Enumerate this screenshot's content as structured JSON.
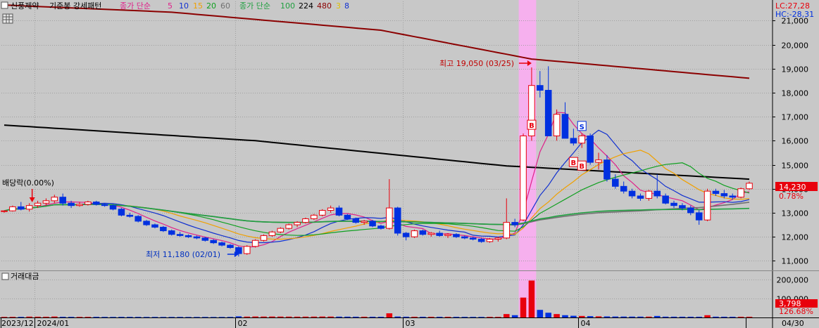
{
  "header": {
    "stock_name": "신풍제약",
    "pattern_label": "기준봉 강세패턴",
    "ma_short_label": "종가 단순",
    "ma_short_periods": [
      "5",
      "10",
      "15",
      "20",
      "60"
    ],
    "ma_long_label": "종가 단순",
    "ma_long_periods": [
      "100",
      "224",
      "480",
      "3",
      "8"
    ]
  },
  "right_top": {
    "lc": "LC:27,28",
    "hc": "HC:-28,31"
  },
  "current": {
    "price_label": "14,230",
    "change_label": "0.78%"
  },
  "volume": {
    "title": "거래대금",
    "current_label": "3,798",
    "pct_label": "126.68%"
  },
  "annotations": {
    "high": "최고 19,050 (03/25)",
    "low": "최저 11,180 (02/01)",
    "dividend": "배당락(0.00%)",
    "buy_mark": "B",
    "sell_mark": "S"
  },
  "colors": {
    "bg": "#c8c8c8",
    "up": "#e8000c",
    "down": "#0030e0",
    "ma5": "#e0208a",
    "ma10": "#1030d0",
    "ma15": "#f0a000",
    "ma20": "#10a020",
    "ma60": "#707070",
    "ma100": "#20a040",
    "ma224": "#000000",
    "ma480": "#8b0000",
    "highlight": "#f6b0ee"
  },
  "chart_data": {
    "type": "candlestick",
    "y_ticks": [
      11000,
      12000,
      13000,
      14000,
      15000,
      16000,
      17000,
      18000,
      19000,
      20000,
      21000
    ],
    "y_tick_labels": [
      "11,000",
      "12,000",
      "13,000",
      "14,000",
      "15,000",
      "16,000",
      "17,000",
      "18,000",
      "19,000",
      "20,000",
      "21,000"
    ],
    "ylim": [
      10600,
      21800
    ],
    "volume_ticks": [
      100000,
      200000
    ],
    "volume_tick_labels": [
      "100,000",
      "200,000"
    ],
    "volume_ylim": [
      0,
      230000
    ],
    "x_labels": [
      {
        "label": "2023/12",
        "index": 0
      },
      {
        "label": "2024/01",
        "index": 4
      },
      {
        "label": "02",
        "index": 28
      },
      {
        "label": "03",
        "index": 48
      },
      {
        "label": "04",
        "index": 69
      },
      {
        "label": "04/30",
        "index": 89
      }
    ],
    "n_candles": 90,
    "high_index": 63,
    "low_index": 28,
    "dividend_index": 3,
    "highlight_range": [
      62,
      63
    ],
    "candles": [
      [
        13050,
        13100,
        13000,
        13080
      ],
      [
        13080,
        13300,
        13050,
        13250
      ],
      [
        13250,
        13450,
        13100,
        13150
      ],
      [
        13150,
        13400,
        13050,
        13300
      ],
      [
        13300,
        13500,
        13200,
        13400
      ],
      [
        13400,
        13600,
        13300,
        13500
      ],
      [
        13500,
        13750,
        13400,
        13650
      ],
      [
        13650,
        13800,
        13300,
        13400
      ],
      [
        13400,
        13500,
        13200,
        13300
      ],
      [
        13300,
        13450,
        13250,
        13350
      ],
      [
        13350,
        13500,
        13300,
        13450
      ],
      [
        13450,
        13500,
        13300,
        13350
      ],
      [
        13350,
        13400,
        13250,
        13300
      ],
      [
        13300,
        13350,
        13100,
        13150
      ],
      [
        13150,
        13200,
        12850,
        12900
      ],
      [
        12900,
        13000,
        12800,
        12850
      ],
      [
        12850,
        12900,
        12600,
        12650
      ],
      [
        12650,
        12700,
        12450,
        12500
      ],
      [
        12500,
        12550,
        12350,
        12400
      ],
      [
        12400,
        12450,
        12200,
        12250
      ],
      [
        12250,
        12300,
        12050,
        12100
      ],
      [
        12100,
        12200,
        12000,
        12050
      ],
      [
        12050,
        12100,
        11950,
        12000
      ],
      [
        12000,
        12050,
        11900,
        11950
      ],
      [
        11950,
        12000,
        11800,
        11850
      ],
      [
        11850,
        11900,
        11700,
        11750
      ],
      [
        11750,
        11800,
        11600,
        11650
      ],
      [
        11650,
        11700,
        11500,
        11550
      ],
      [
        11550,
        11600,
        11180,
        11300
      ],
      [
        11300,
        11650,
        11250,
        11600
      ],
      [
        11600,
        11900,
        11550,
        11850
      ],
      [
        11850,
        12100,
        11800,
        12050
      ],
      [
        12050,
        12250,
        12000,
        12200
      ],
      [
        12200,
        12400,
        12150,
        12350
      ],
      [
        12350,
        12550,
        12300,
        12500
      ],
      [
        12500,
        12650,
        12400,
        12600
      ],
      [
        12600,
        12800,
        12550,
        12750
      ],
      [
        12750,
        12950,
        12700,
        12900
      ],
      [
        12900,
        13150,
        12850,
        13100
      ],
      [
        13100,
        13300,
        13000,
        13200
      ],
      [
        13200,
        13300,
        12850,
        12900
      ],
      [
        12900,
        12950,
        12700,
        12750
      ],
      [
        12750,
        12800,
        12550,
        12600
      ],
      [
        12600,
        12700,
        12500,
        12650
      ],
      [
        12650,
        12700,
        12400,
        12450
      ],
      [
        12450,
        12500,
        12300,
        12350
      ],
      [
        12350,
        14400,
        12300,
        13200
      ],
      [
        13200,
        13250,
        12050,
        12150
      ],
      [
        12150,
        12200,
        11850,
        12000
      ],
      [
        12000,
        12300,
        11950,
        12250
      ],
      [
        12250,
        12300,
        12050,
        12100
      ],
      [
        12100,
        12200,
        12000,
        12150
      ],
      [
        12150,
        12250,
        12000,
        12050
      ],
      [
        12050,
        12150,
        11950,
        12100
      ],
      [
        12100,
        12150,
        11950,
        12000
      ],
      [
        12000,
        12050,
        11900,
        11950
      ],
      [
        11950,
        12000,
        11850,
        11900
      ],
      [
        11900,
        11950,
        11750,
        11800
      ],
      [
        11800,
        11950,
        11750,
        11900
      ],
      [
        11900,
        12000,
        11800,
        11950
      ],
      [
        11950,
        13600,
        11900,
        12600
      ],
      [
        12600,
        12750,
        12400,
        12500
      ],
      [
        12700,
        16300,
        12650,
        16200
      ],
      [
        16200,
        19050,
        16000,
        18300
      ],
      [
        18300,
        18900,
        17800,
        18100
      ],
      [
        18100,
        19100,
        16200,
        16200
      ],
      [
        16200,
        17300,
        16000,
        17100
      ],
      [
        17100,
        17600,
        16100,
        16100
      ],
      [
        16100,
        16500,
        15800,
        15900
      ],
      [
        15900,
        16300,
        15700,
        16200
      ],
      [
        16200,
        16300,
        15000,
        15100
      ],
      [
        15100,
        15500,
        14800,
        15200
      ],
      [
        15200,
        15400,
        14300,
        14400
      ],
      [
        14400,
        14600,
        14000,
        14100
      ],
      [
        14100,
        14300,
        13800,
        13900
      ],
      [
        13900,
        14000,
        13600,
        13700
      ],
      [
        13700,
        13800,
        13500,
        13600
      ],
      [
        13600,
        13950,
        13500,
        13900
      ],
      [
        13900,
        14600,
        13600,
        13700
      ],
      [
        13700,
        13800,
        13350,
        13400
      ],
      [
        13400,
        13500,
        13200,
        13300
      ],
      [
        13300,
        13400,
        13100,
        13200
      ],
      [
        13200,
        13300,
        12900,
        13000
      ],
      [
        13000,
        13100,
        12500,
        12700
      ],
      [
        12700,
        14000,
        12650,
        13900
      ],
      [
        13900,
        14000,
        13700,
        13800
      ],
      [
        13800,
        13950,
        13600,
        13700
      ],
      [
        13700,
        13800,
        13550,
        13650
      ],
      [
        13650,
        14050,
        13600,
        14000
      ],
      [
        14000,
        14300,
        13950,
        14230
      ]
    ],
    "volumes": [
      3000,
      3200,
      3100,
      4500,
      4000,
      3800,
      5000,
      3500,
      3200,
      3000,
      3100,
      3300,
      3000,
      2900,
      3200,
      3100,
      3000,
      2800,
      2900,
      2700,
      2800,
      2900,
      2600,
      2700,
      2800,
      2600,
      2700,
      2900,
      6000,
      4500,
      5200,
      4800,
      5000,
      4700,
      4500,
      4200,
      4400,
      4600,
      5000,
      4800,
      4400,
      4200,
      4000,
      3900,
      3800,
      3700,
      22000,
      5000,
      4000,
      3800,
      3700,
      3600,
      3500,
      3400,
      3300,
      3200,
      3100,
      3000,
      3200,
      3100,
      18000,
      12000,
      105000,
      195000,
      40000,
      25000,
      18000,
      12000,
      9000,
      8000,
      7000,
      6000,
      5500,
      5000,
      4800,
      4600,
      4500,
      4400,
      8000,
      4300,
      4100,
      4000,
      3900,
      3800,
      12000,
      4200,
      3900,
      3700,
      3800,
      3798
    ],
    "series": [
      {
        "name": "5",
        "key": "ma5",
        "period": 5
      },
      {
        "name": "10",
        "key": "ma10",
        "period": 10
      },
      {
        "name": "15",
        "key": "ma15",
        "period": 15
      },
      {
        "name": "20",
        "key": "ma20",
        "period": 20
      },
      {
        "name": "60",
        "key": "ma60",
        "period": 60
      },
      {
        "name": "100",
        "key": "ma100",
        "period": 100
      }
    ],
    "ma224": {
      "name": "224",
      "points": [
        [
          0,
          16650
        ],
        [
          30,
          16000
        ],
        [
          60,
          14950
        ],
        [
          89,
          14400
        ]
      ]
    },
    "ma480": {
      "name": "480",
      "points": [
        [
          0,
          21650
        ],
        [
          20,
          21350
        ],
        [
          45,
          20600
        ],
        [
          63,
          19400
        ],
        [
          89,
          18600
        ]
      ]
    },
    "signals": [
      {
        "type": "B",
        "index": 63,
        "price": 16650
      },
      {
        "type": "S",
        "index": 69,
        "price": 16600
      },
      {
        "type": "B",
        "index": 68,
        "price": 15100
      },
      {
        "type": "B",
        "index": 69,
        "price": 14950
      }
    ]
  }
}
